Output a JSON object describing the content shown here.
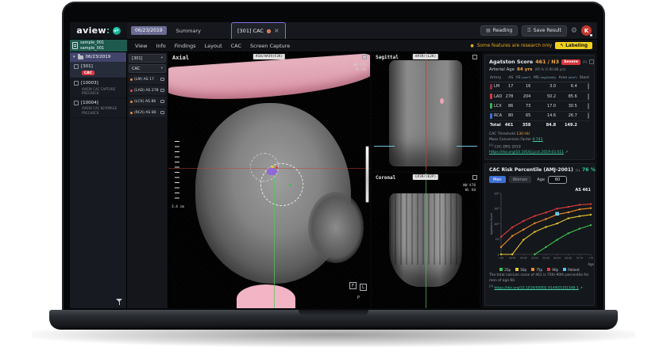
{
  "header": {
    "logo_text": "aview",
    "logo_colon": ":",
    "date_tab": "06/23/2019",
    "summary_tab": "Summary",
    "active_tab": "[301] CAC",
    "close": "×",
    "reading_label": "Reading",
    "save_label": "Save Result",
    "avatar_initial": "K"
  },
  "research_row": {
    "note": "Some features are research only",
    "labeling_label": "Labeling",
    "labeling_cursor": "↖"
  },
  "sidebar": {
    "patient_line1": "sample_001",
    "patient_line2": "sample_001",
    "folder": "06/23/2019",
    "items": [
      {
        "id": "[301]",
        "badge": "CAC",
        "selected": true
      },
      {
        "id": "[10003]",
        "desc": "AVIEW CAC CAPTURE PRECHECK"
      },
      {
        "id": "[10004]",
        "desc": "AVIEW CAC KEYIMAGE PRECHECK"
      }
    ]
  },
  "menu": {
    "items": [
      "View",
      "Info",
      "Findings",
      "Layout",
      "CAC",
      "Screen Capture"
    ]
  },
  "findings": {
    "series_dropdown": "[301]",
    "type_dropdown": "CAC",
    "items": [
      {
        "label": "(LM) AS 17",
        "color": "#f08c3c"
      },
      {
        "label": "(LAD) AS 278",
        "color": "#e5484d"
      },
      {
        "label": "(LCX) AS 86",
        "color": "#f08c3c"
      },
      {
        "label": "(RCA) AS 80",
        "color": "#f08c3c"
      }
    ]
  },
  "viewports": {
    "axial": {
      "label": "Axial",
      "chip": "#18/A#39(F2K)",
      "ww": "WW 470",
      "wl": "WL 60",
      "ruler": "3.4 cm",
      "orient_f": "F",
      "orient_l": "L",
      "orient_p": "P"
    },
    "sagittal": {
      "label": "Sagittal",
      "chip": "A#39/(L2K)"
    },
    "coronal": {
      "label": "Coronal",
      "chip": "C#39/(K2P)",
      "ww": "WW 470",
      "wl": "WL 60"
    }
  },
  "score_panel": {
    "title": "Agatston Score",
    "value": "461 / N3",
    "badge": "Severe",
    "sup": "[1]",
    "arterial_label": "Arterial Age",
    "arterial_value": "84 yrs",
    "arterial_ci": "(95 % CI 80-88 yrs)",
    "table": {
      "headers": [
        "Artery",
        "AS",
        "VS",
        "MS",
        "Area",
        "Stent"
      ],
      "units": [
        "",
        "",
        "(mm³)",
        "(mg/CaHA)",
        "(mm²)",
        ""
      ],
      "rows": [
        {
          "artery": "LM",
          "color": "#8e2f45",
          "as": "17",
          "vs": "16",
          "ms": "3.0",
          "area": "6.4"
        },
        {
          "artery": "LAD",
          "color": "#d43d3d",
          "as": "278",
          "vs": "204",
          "ms": "50.2",
          "area": "85.6"
        },
        {
          "artery": "LCX",
          "color": "#3faf4f",
          "as": "86",
          "vs": "73",
          "ms": "17.0",
          "area": "30.5"
        },
        {
          "artery": "RCA",
          "color": "#3f6fd4",
          "as": "80",
          "vs": "65",
          "ms": "14.6",
          "area": "26.7"
        }
      ],
      "total": {
        "artery": "Total",
        "as": "461",
        "vs": "358",
        "ms": "84.8",
        "area": "149.2"
      }
    },
    "threshold_label": "CAC Threshold",
    "threshold_value": "130 HU",
    "mass_label": "Mass Conversion Factor",
    "mass_value": "0.743",
    "ref_sup": "[1]",
    "ref_label": "CAC-DRS 2019",
    "ref_link": "https://doi.org/10.1016/j.jcct.2019.03.011"
  },
  "risk_panel": {
    "title": "CAC Risk Percentile (AMJ-2001)",
    "sup": "[2]",
    "value": "76 %",
    "toggle_men": "Men",
    "toggle_women": "Women",
    "age_label": "Age",
    "age_value": "60",
    "footnote": "The total calcium score of 461 is 75th-90th percentile for men of age 60.",
    "link_sup": "[2]",
    "link": "https://doi.org/10.1016/S0002-9149(01)01548-1"
  },
  "chart_data": {
    "type": "line",
    "title": "CAC Risk Percentile (AMJ-2001)",
    "annotation": "AS 461",
    "x": [
      "<40",
      "40-44",
      "45-49",
      "50-54",
      "55-59",
      "60-64",
      "65-69",
      "70-74",
      ">74"
    ],
    "xlabel": "Age",
    "ylabel": "Agatston Score",
    "yscale": "log",
    "ylim": [
      1,
      10000
    ],
    "yticks": [
      "1",
      "10",
      "10²",
      "10³",
      "10⁴"
    ],
    "legend_position": "bottom",
    "series": [
      {
        "name": "25p",
        "color": "#3dc24b",
        "values": [
          null,
          null,
          null,
          1,
          3,
          9,
          24,
          48,
          82
        ]
      },
      {
        "name": "50p",
        "color": "#e8c832",
        "values": [
          1,
          1,
          9,
          30,
          62,
          105,
          230,
          320,
          400
        ]
      },
      {
        "name": "75p",
        "color": "#f08c28",
        "values": [
          3,
          16,
          42,
          110,
          205,
          410,
          570,
          890,
          1070
        ]
      },
      {
        "name": "90p",
        "color": "#e03c3c",
        "values": [
          14,
          59,
          155,
          330,
          555,
          995,
          1300,
          1770,
          1980
        ]
      },
      {
        "name": "Patient",
        "color": "#52c8f0",
        "type": "point",
        "x_index": 5,
        "value": 461
      }
    ]
  },
  "colors": {
    "accent_teal": "#20c4a7",
    "accent_orange": "#f5a742",
    "severe_red": "#d9363e",
    "success_green": "#2ecc8f",
    "link_teal": "#3fd0a8",
    "labeling_yellow": "#f2d21f"
  }
}
